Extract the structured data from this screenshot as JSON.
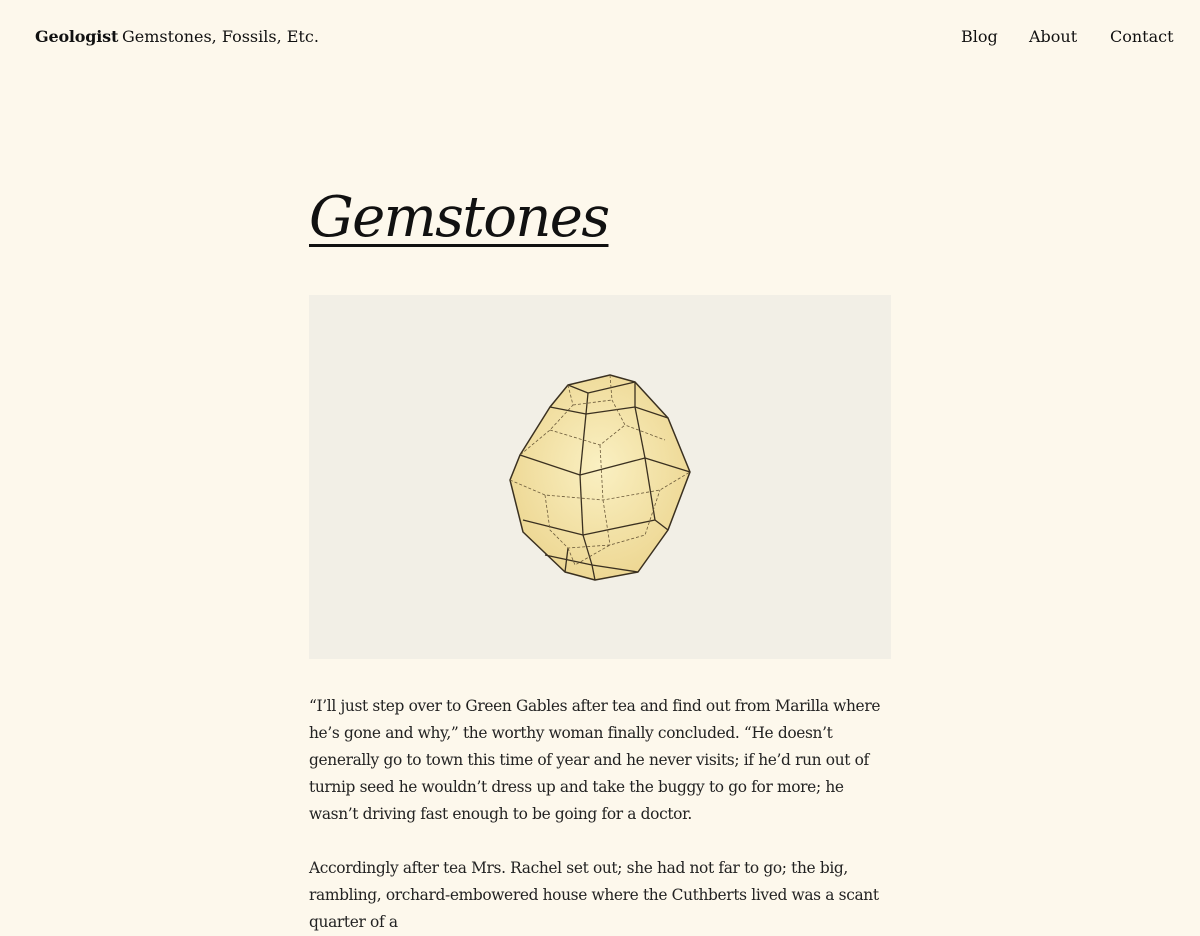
{
  "header": {
    "site_title": "Geologist",
    "tagline": "Gemstones, Fossils, Etc.",
    "nav": [
      "Blog",
      "About",
      "Contact"
    ]
  },
  "main": {
    "title": "Gemstones",
    "figure": {
      "icon": "gemstone-crystal-illustration"
    },
    "paragraphs": [
      "“I’ll just step over to Green Gables after tea and find out from Marilla where he’s gone and why,” the worthy woman finally concluded. “He doesn’t generally go to town this time of year and he never visits; if he’d run out of turnip seed he wouldn’t dress up and take the buggy to go for more; he wasn’t driving fast enough to be going for a doctor.",
      "Accordingly after tea Mrs. Rachel set out; she had not far to go; the big, rambling, orchard-embowered house where the Cuthberts lived was a scant quarter of a"
    ]
  },
  "colors": {
    "background": "#fdf8ec",
    "figure_background": "#f2efe6",
    "crystal_fill": "#f5e7b0",
    "crystal_stroke": "#3a3020"
  }
}
